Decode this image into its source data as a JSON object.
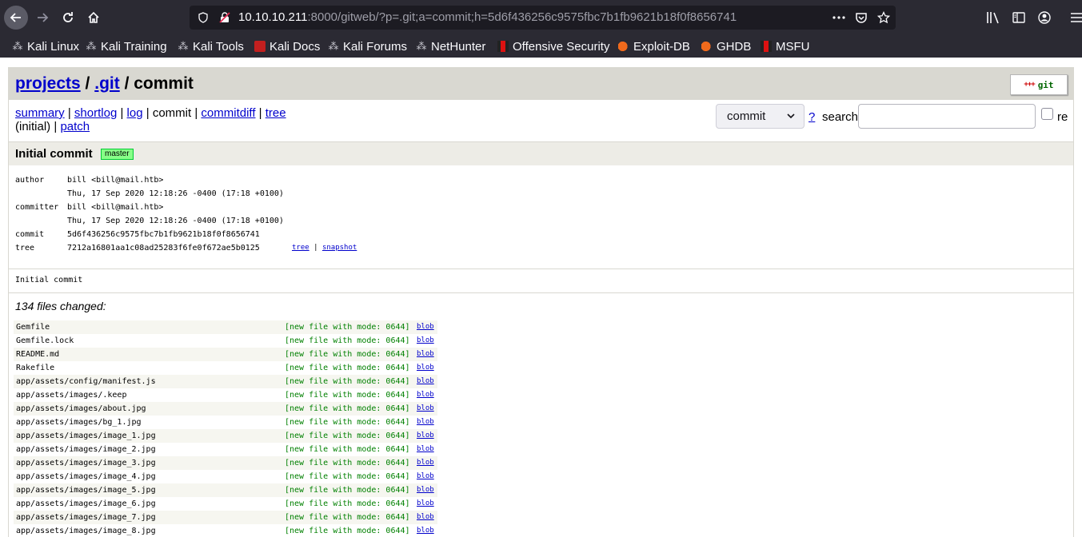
{
  "browser": {
    "url_host": "10.10.10.211",
    "url_rest": ":8000/gitweb/?p=.git;a=commit;h=5d6f436256c9575fbc7b1fb9621b18f0f8656741",
    "bookmarks": [
      "Kali Linux",
      "Kali Training",
      "Kali Tools",
      "Kali Docs",
      "Kali Forums",
      "NetHunter",
      "Offensive Security",
      "Exploit-DB",
      "GHDB",
      "MSFU"
    ]
  },
  "header": {
    "projects": "projects",
    "sep1": "/",
    "repo": ".git",
    "sep2": "/ commit",
    "logo_plus": "+++",
    "logo_word": "git"
  },
  "nav": {
    "summary": "summary",
    "shortlog": "shortlog",
    "log": "log",
    "commit": "commit",
    "commitdiff": "commitdiff",
    "tree": "tree",
    "initial": "(initial)",
    "patch": "patch",
    "pipe": "|"
  },
  "search": {
    "select_value": "commit",
    "help": "?",
    "label": "search:",
    "re_label": "re"
  },
  "commit": {
    "title": "Initial commit",
    "branch_badge": "master",
    "author_key": "author",
    "author": "bill <bill@mail.htb>",
    "author_date": "Thu, 17 Sep 2020 12:18:26 -0400 (17:18 +0100)",
    "committer_key": "committer",
    "committer": "bill <bill@mail.htb>",
    "committer_date": "Thu, 17 Sep 2020 12:18:26 -0400 (17:18 +0100)",
    "commit_key": "commit",
    "hash": "5d6f436256c9575fbc7b1fb9621b18f0f8656741",
    "tree_key": "tree",
    "tree_hash": "7212a16801aa1c08ad25283f6fe0f672ae5b0125",
    "tree_link": "tree",
    "snapshot_link": "snapshot",
    "message": "Initial commit",
    "files_changed": "134 files changed:"
  },
  "files": [
    {
      "name": "Gemfile",
      "mode": "[new file with mode: 0644]",
      "link": "blob"
    },
    {
      "name": "Gemfile.lock",
      "mode": "[new file with mode: 0644]",
      "link": "blob"
    },
    {
      "name": "README.md",
      "mode": "[new file with mode: 0644]",
      "link": "blob"
    },
    {
      "name": "Rakefile",
      "mode": "[new file with mode: 0644]",
      "link": "blob"
    },
    {
      "name": "app/assets/config/manifest.js",
      "mode": "[new file with mode: 0644]",
      "link": "blob"
    },
    {
      "name": "app/assets/images/.keep",
      "mode": "[new file with mode: 0644]",
      "link": "blob"
    },
    {
      "name": "app/assets/images/about.jpg",
      "mode": "[new file with mode: 0644]",
      "link": "blob"
    },
    {
      "name": "app/assets/images/bg_1.jpg",
      "mode": "[new file with mode: 0644]",
      "link": "blob"
    },
    {
      "name": "app/assets/images/image_1.jpg",
      "mode": "[new file with mode: 0644]",
      "link": "blob"
    },
    {
      "name": "app/assets/images/image_2.jpg",
      "mode": "[new file with mode: 0644]",
      "link": "blob"
    },
    {
      "name": "app/assets/images/image_3.jpg",
      "mode": "[new file with mode: 0644]",
      "link": "blob"
    },
    {
      "name": "app/assets/images/image_4.jpg",
      "mode": "[new file with mode: 0644]",
      "link": "blob"
    },
    {
      "name": "app/assets/images/image_5.jpg",
      "mode": "[new file with mode: 0644]",
      "link": "blob"
    },
    {
      "name": "app/assets/images/image_6.jpg",
      "mode": "[new file with mode: 0644]",
      "link": "blob"
    },
    {
      "name": "app/assets/images/image_7.jpg",
      "mode": "[new file with mode: 0644]",
      "link": "blob"
    },
    {
      "name": "app/assets/images/image_8.jpg",
      "mode": "[new file with mode: 0644]",
      "link": "blob"
    }
  ]
}
